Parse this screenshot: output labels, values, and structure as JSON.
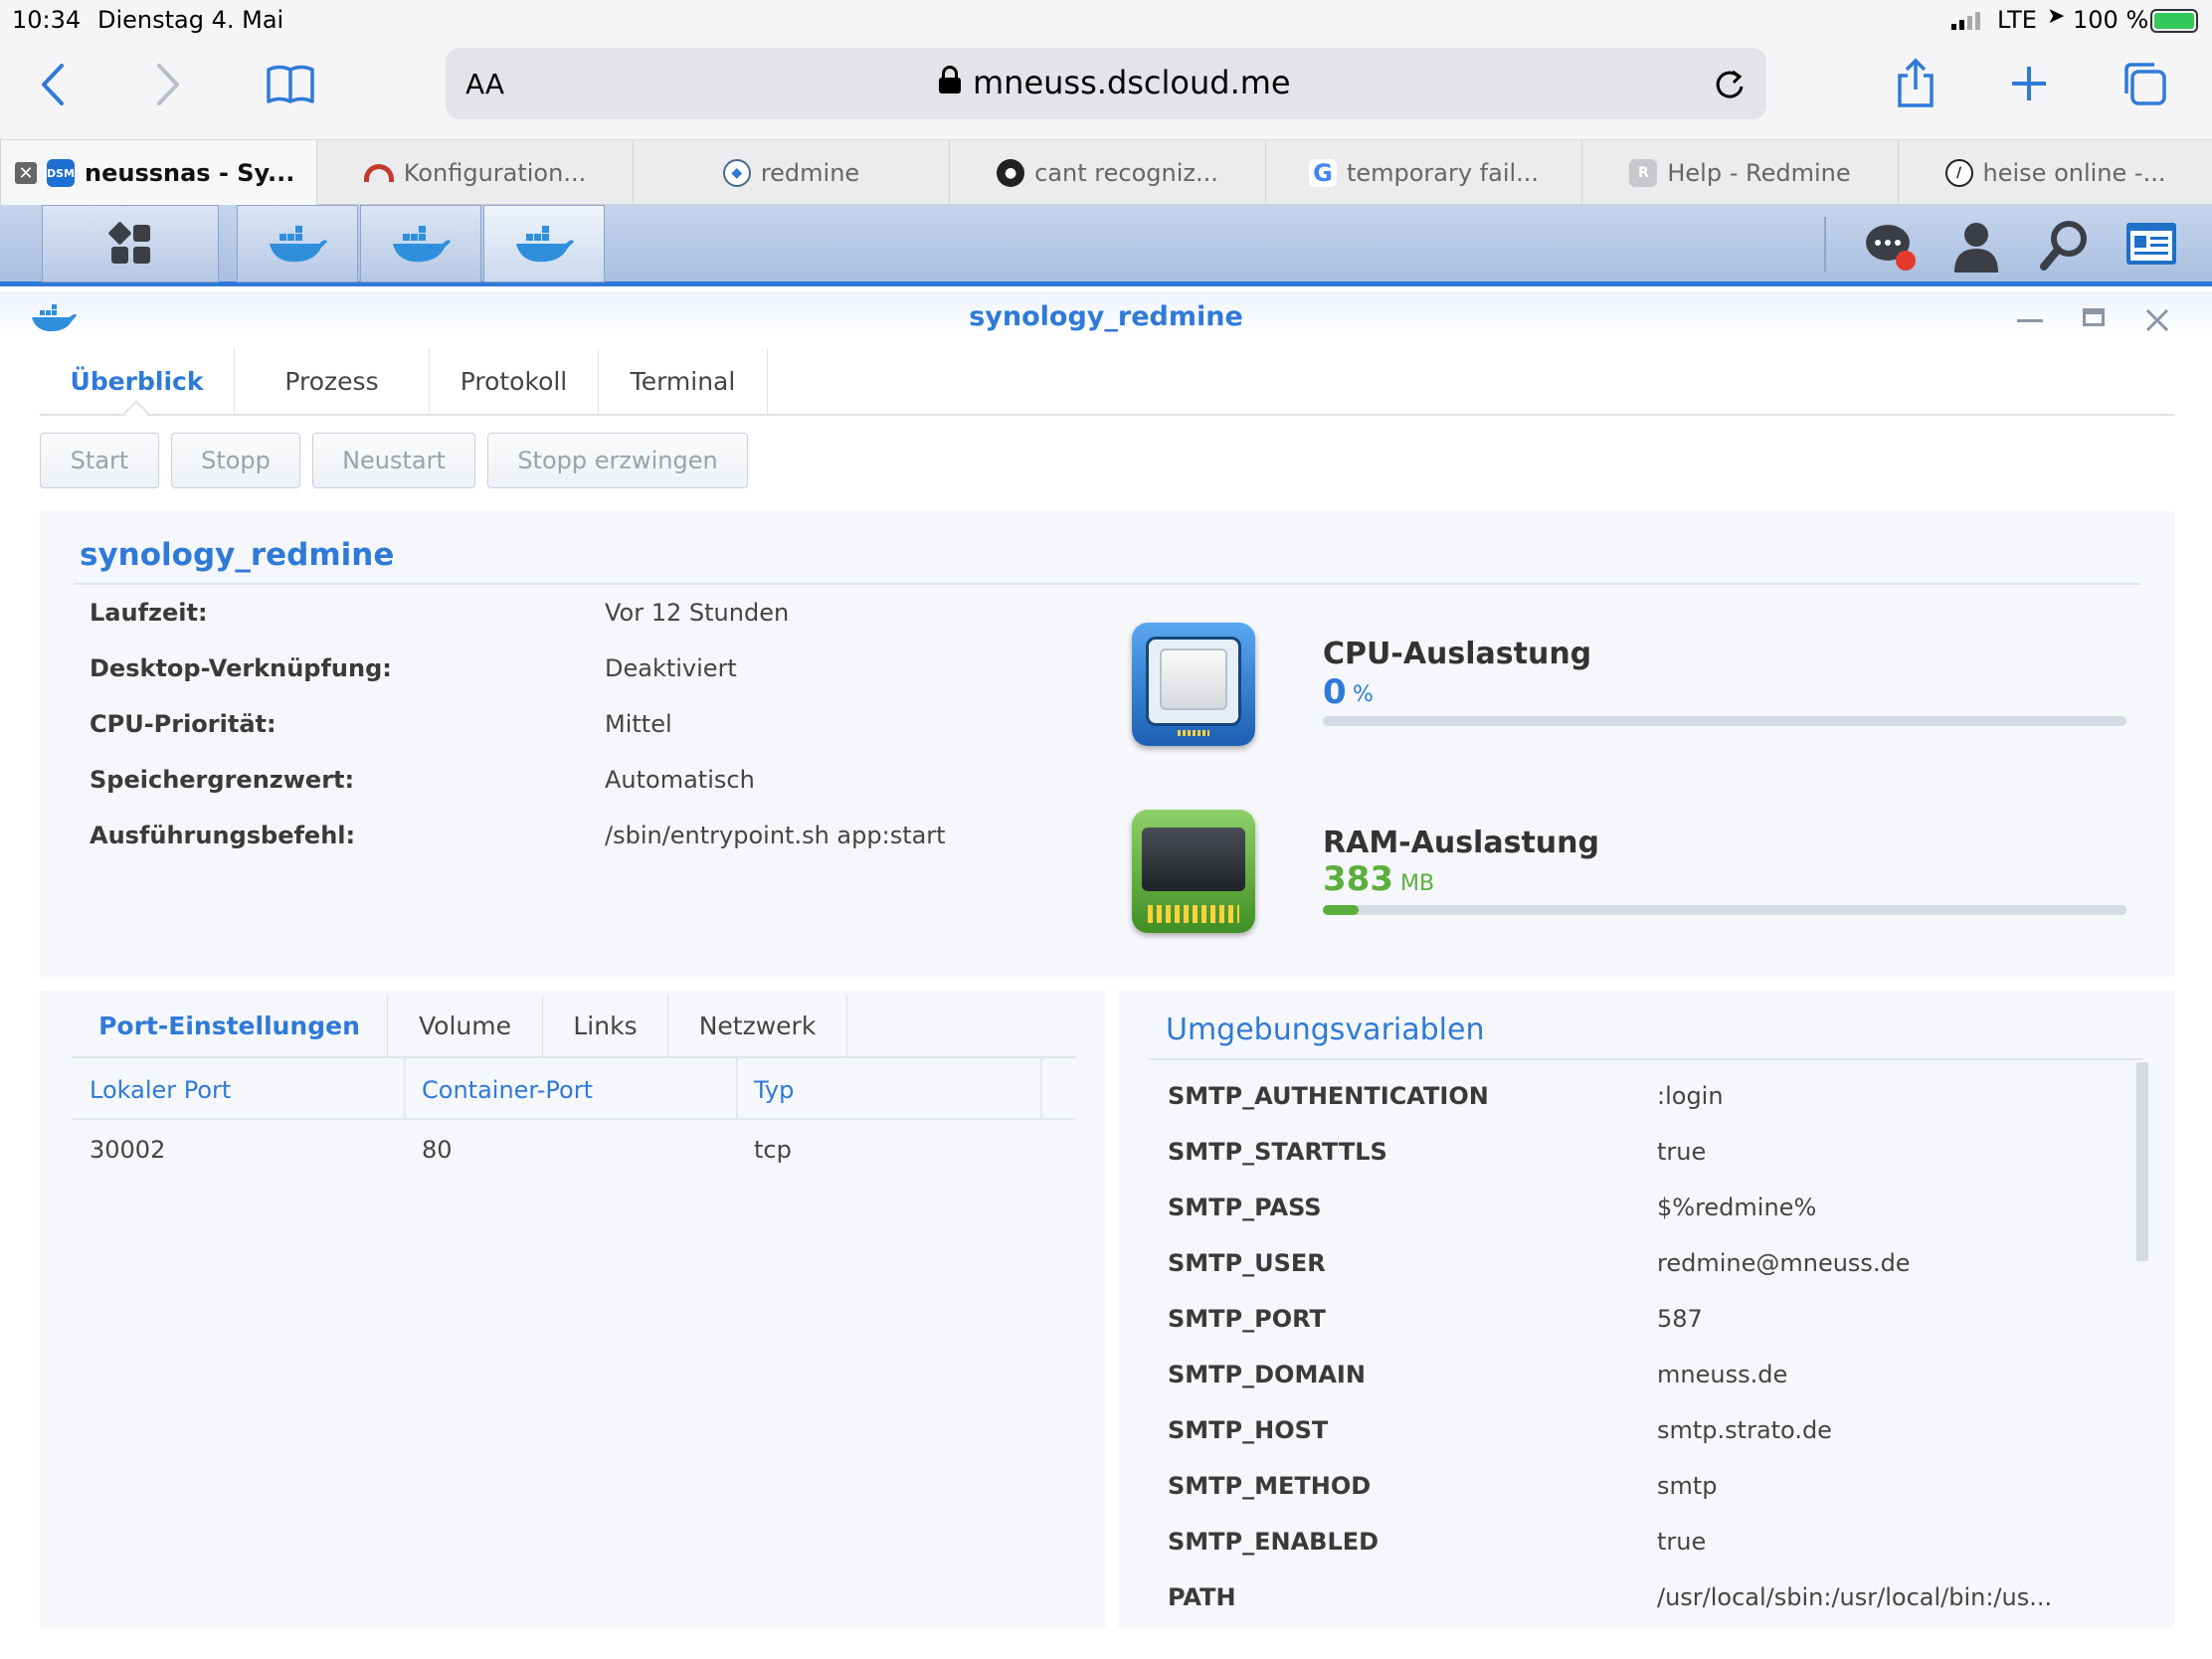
{
  "status_bar": {
    "time": "10:34",
    "date": "Dienstag 4. Mai",
    "network": "LTE",
    "battery": "100 %"
  },
  "browser": {
    "text_size_label": "AA",
    "url": "mneuss.dscloud.me",
    "tabs": [
      {
        "label": "neussnas - Sy...",
        "favicon": "DSM"
      },
      {
        "label": "Konfiguration..."
      },
      {
        "label": "redmine"
      },
      {
        "label": "cant recogniz..."
      },
      {
        "label": "temporary fail..."
      },
      {
        "label": "Help - Redmine",
        "favicon": "R"
      },
      {
        "label": "heise online -..."
      }
    ]
  },
  "window": {
    "title": "synology_redmine"
  },
  "main_tabs": [
    "Überblick",
    "Prozess",
    "Protokoll",
    "Terminal"
  ],
  "actions": [
    "Start",
    "Stopp",
    "Neustart",
    "Stopp erzwingen"
  ],
  "overview": {
    "name": "synology_redmine",
    "rows": [
      {
        "label": "Laufzeit:",
        "value": "Vor 12 Stunden"
      },
      {
        "label": "Desktop-Verknüpfung:",
        "value": "Deaktiviert"
      },
      {
        "label": "CPU-Priorität:",
        "value": "Mittel"
      },
      {
        "label": "Speichergrenzwert:",
        "value": "Automatisch"
      },
      {
        "label": "Ausführungsbefehl:",
        "value": "/sbin/entrypoint.sh app:start"
      }
    ],
    "cpu": {
      "title": "CPU-Auslastung",
      "value": "0",
      "unit": "%",
      "fraction": 0.0
    },
    "ram": {
      "title": "RAM-Auslastung",
      "value": "383",
      "unit": "MB",
      "fraction": 0.045
    }
  },
  "sub_tabs": [
    "Port-Einstellungen",
    "Volume",
    "Links",
    "Netzwerk"
  ],
  "ports": {
    "headers": [
      "Lokaler Port",
      "Container-Port",
      "Typ"
    ],
    "rows": [
      [
        "30002",
        "80",
        "tcp"
      ]
    ]
  },
  "env": {
    "title": "Umgebungsvariablen",
    "rows": [
      [
        "SMTP_AUTHENTICATION",
        ":login"
      ],
      [
        "SMTP_STARTTLS",
        "true"
      ],
      [
        "SMTP_PASS",
        "$%redmine%"
      ],
      [
        "SMTP_USER",
        "redmine@mneuss.de"
      ],
      [
        "SMTP_PORT",
        "587"
      ],
      [
        "SMTP_DOMAIN",
        "mneuss.de"
      ],
      [
        "SMTP_HOST",
        "smtp.strato.de"
      ],
      [
        "SMTP_METHOD",
        "smtp"
      ],
      [
        "SMTP_ENABLED",
        "true"
      ],
      [
        "PATH",
        "/usr/local/sbin:/usr/local/bin:/us..."
      ]
    ]
  },
  "colors": {
    "accent": "#2f7ad8",
    "ram_green": "#5cae3c",
    "cpu_blue": "#2f7ad8"
  }
}
